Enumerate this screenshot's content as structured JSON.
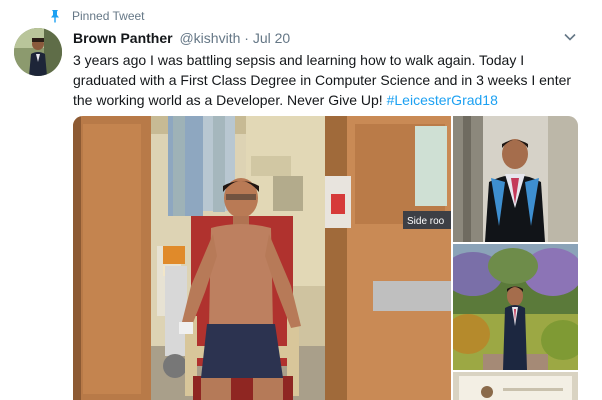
{
  "pinned": {
    "label": "Pinned Tweet",
    "icon": "pin-icon"
  },
  "author": {
    "display_name": "Brown Panther",
    "handle": "@kishvith",
    "separator": "·",
    "date": "Jul 20"
  },
  "menu": {
    "icon": "chevron-down-icon"
  },
  "tweet": {
    "text": "3 years ago I was battling sepsis and learning how to walk again. Today I graduated with a First Class Degree in Computer Science and in 3 weeks I enter the working world as a Developer. Never Give Up!",
    "hashtag": "#LeicesterGrad18"
  },
  "media": {
    "main": {
      "door_sign": "Side roo"
    }
  },
  "colors": {
    "link": "#1da1f2",
    "secondary_text": "#657786",
    "primary_text": "#14171a"
  }
}
